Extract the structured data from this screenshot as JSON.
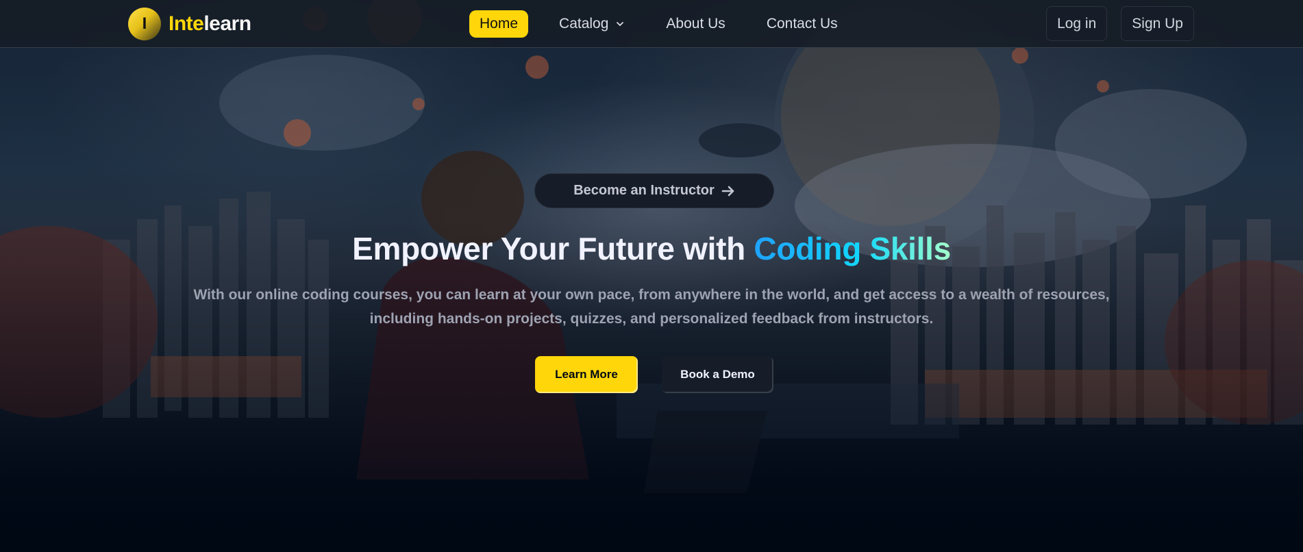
{
  "brand": {
    "badge_letter": "I",
    "name_accent": "Inte",
    "name_rest": "learn"
  },
  "nav": {
    "items": [
      {
        "label": "Home",
        "active": true
      },
      {
        "label": "Catalog",
        "has_dropdown": true
      },
      {
        "label": "About Us"
      },
      {
        "label": "Contact Us"
      }
    ],
    "login_label": "Log in",
    "signup_label": "Sign Up"
  },
  "hero": {
    "instructor_cta": "Become an Instructor",
    "headline_plain": "Empower Your Future with ",
    "headline_highlight": "Coding Skills",
    "subtext": "With our online coding courses, you can learn at your own pace, from anywhere in the world, and get access to a wealth of resources, including hands-on projects, quizzes, and personalized feedback from instructors.",
    "primary_cta": "Learn More",
    "secondary_cta": "Book a Demo"
  },
  "colors": {
    "accent_yellow": "#ffd60a",
    "dark_surface": "#161d29",
    "page_background": "#000814",
    "gradient_text": [
      "#1fa2ff",
      "#12d8fa",
      "#a6ffcb"
    ]
  },
  "icons": {
    "catalog_dropdown": "chevron-down-icon",
    "instructor_arrow": "arrow-right-icon"
  }
}
